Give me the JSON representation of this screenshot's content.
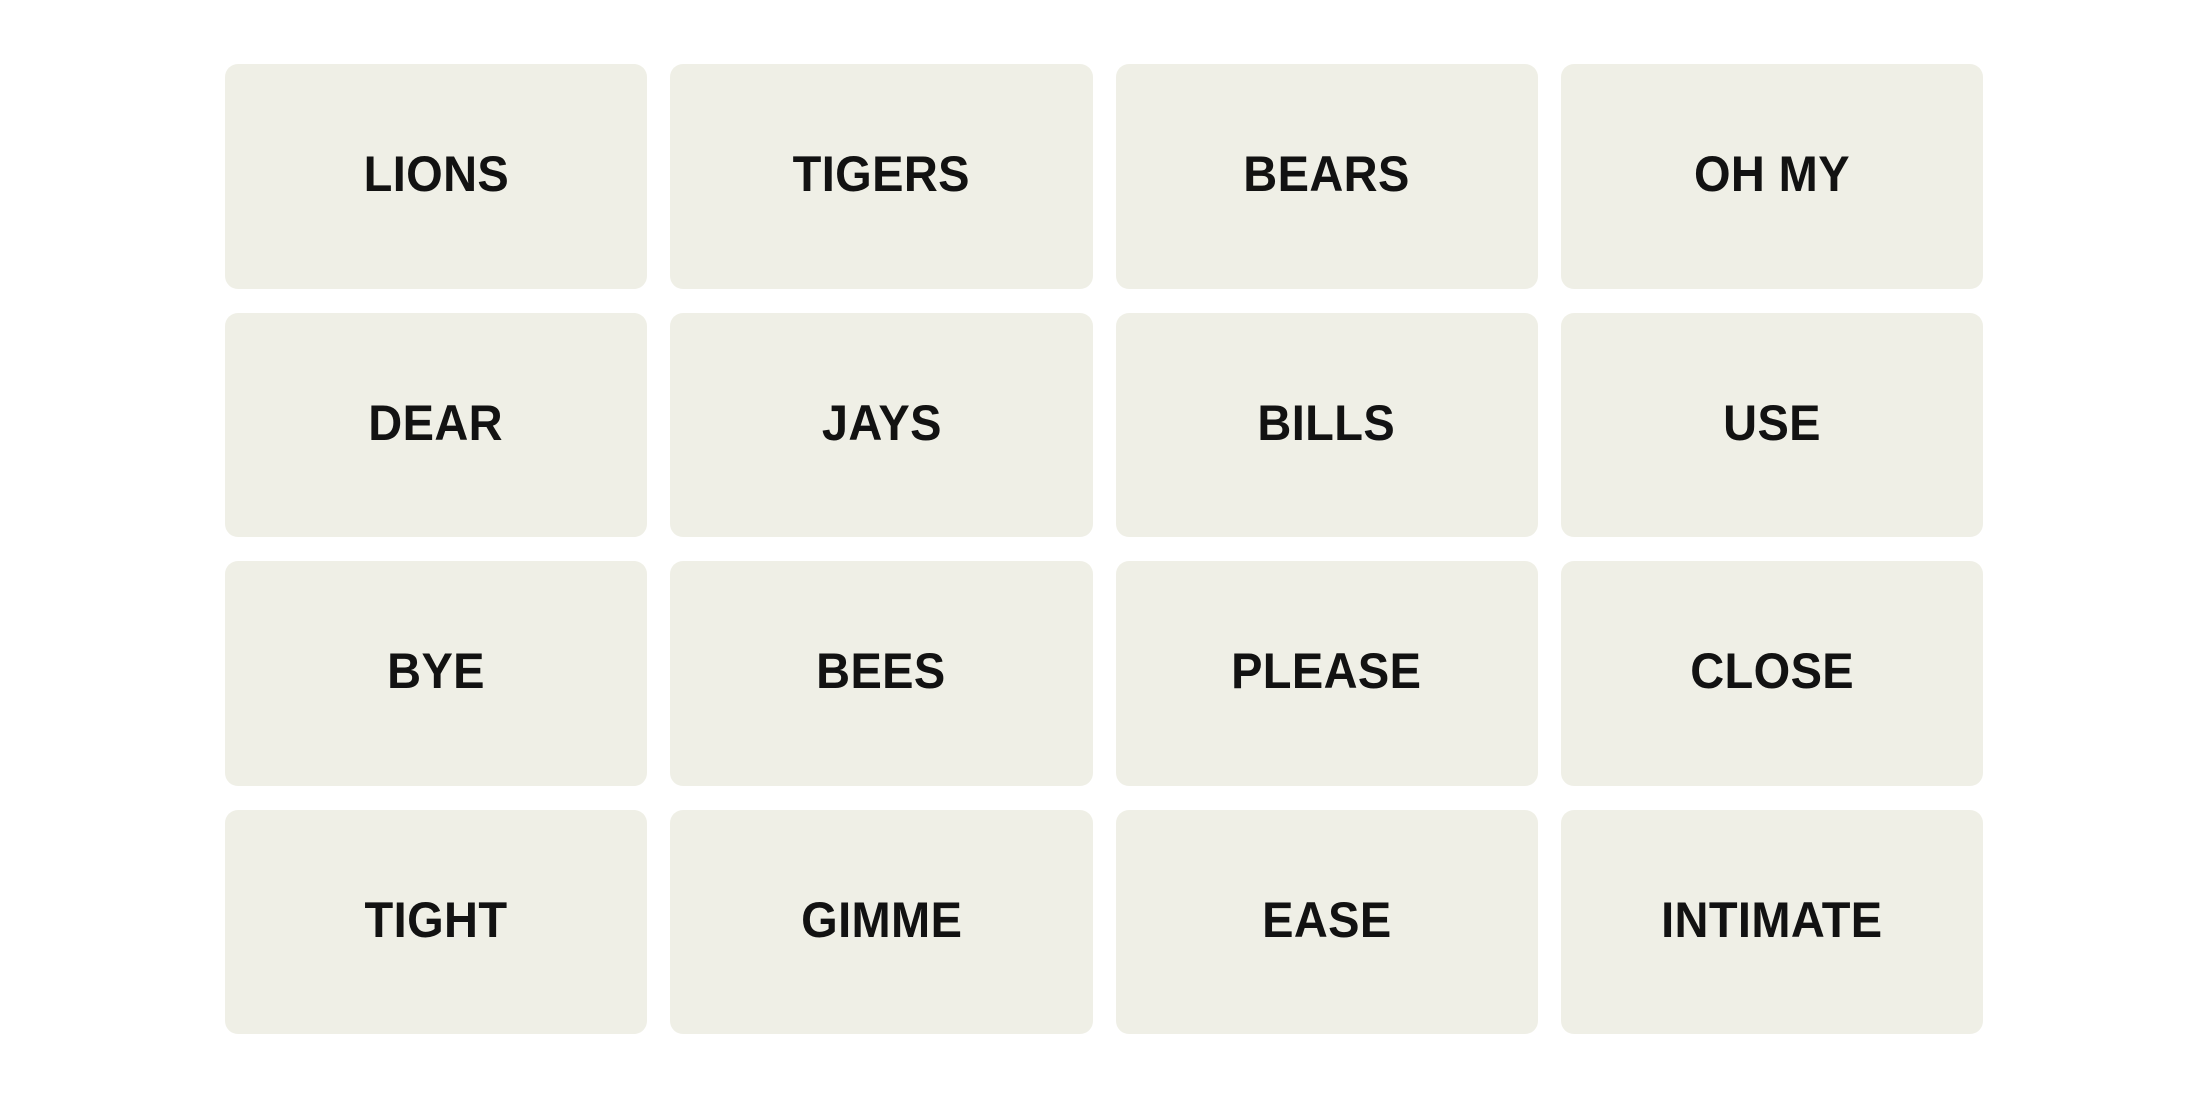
{
  "app": {
    "name": "word-grouping-puzzle",
    "background_color": "#FFFFFF"
  },
  "board": {
    "rows": 4,
    "columns": 4,
    "tile_color": "#EFEFE6",
    "tile_text_color": "#121212",
    "tiles": [
      {
        "label": "LIONS",
        "row": 1,
        "col": 1,
        "selected": false
      },
      {
        "label": "TIGERS",
        "row": 1,
        "col": 2,
        "selected": false
      },
      {
        "label": "BEARS",
        "row": 1,
        "col": 3,
        "selected": false
      },
      {
        "label": "OH MY",
        "row": 1,
        "col": 4,
        "selected": false
      },
      {
        "label": "DEAR",
        "row": 2,
        "col": 1,
        "selected": false
      },
      {
        "label": "JAYS",
        "row": 2,
        "col": 2,
        "selected": false
      },
      {
        "label": "BILLS",
        "row": 2,
        "col": 3,
        "selected": false
      },
      {
        "label": "USE",
        "row": 2,
        "col": 4,
        "selected": false
      },
      {
        "label": "BYE",
        "row": 3,
        "col": 1,
        "selected": false
      },
      {
        "label": "BEES",
        "row": 3,
        "col": 2,
        "selected": false
      },
      {
        "label": "PLEASE",
        "row": 3,
        "col": 3,
        "selected": false
      },
      {
        "label": "CLOSE",
        "row": 3,
        "col": 4,
        "selected": false
      },
      {
        "label": "TIGHT",
        "row": 4,
        "col": 1,
        "selected": false
      },
      {
        "label": "GIMME",
        "row": 4,
        "col": 2,
        "selected": false
      },
      {
        "label": "EASE",
        "row": 4,
        "col": 3,
        "selected": false
      },
      {
        "label": "INTIMATE",
        "row": 4,
        "col": 4,
        "selected": false
      }
    ]
  }
}
